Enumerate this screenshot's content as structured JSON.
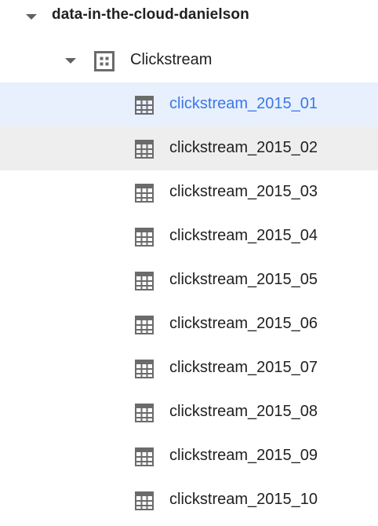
{
  "project": {
    "name": "data-in-the-cloud-danielson",
    "icon": "caret-down-icon"
  },
  "dataset": {
    "name": "Clickstream",
    "icon": "dataset-icon"
  },
  "tables": [
    {
      "name": "clickstream_2015_01",
      "state": "selected"
    },
    {
      "name": "clickstream_2015_02",
      "state": "hovered"
    },
    {
      "name": "clickstream_2015_03",
      "state": ""
    },
    {
      "name": "clickstream_2015_04",
      "state": ""
    },
    {
      "name": "clickstream_2015_05",
      "state": ""
    },
    {
      "name": "clickstream_2015_06",
      "state": ""
    },
    {
      "name": "clickstream_2015_07",
      "state": ""
    },
    {
      "name": "clickstream_2015_08",
      "state": ""
    },
    {
      "name": "clickstream_2015_09",
      "state": ""
    },
    {
      "name": "clickstream_2015_10",
      "state": ""
    }
  ],
  "colors": {
    "selected_bg": "#e8f0fe",
    "selected_text": "#3b78e7",
    "hover_bg": "#eeeeee",
    "icon": "#6b6b6b"
  }
}
